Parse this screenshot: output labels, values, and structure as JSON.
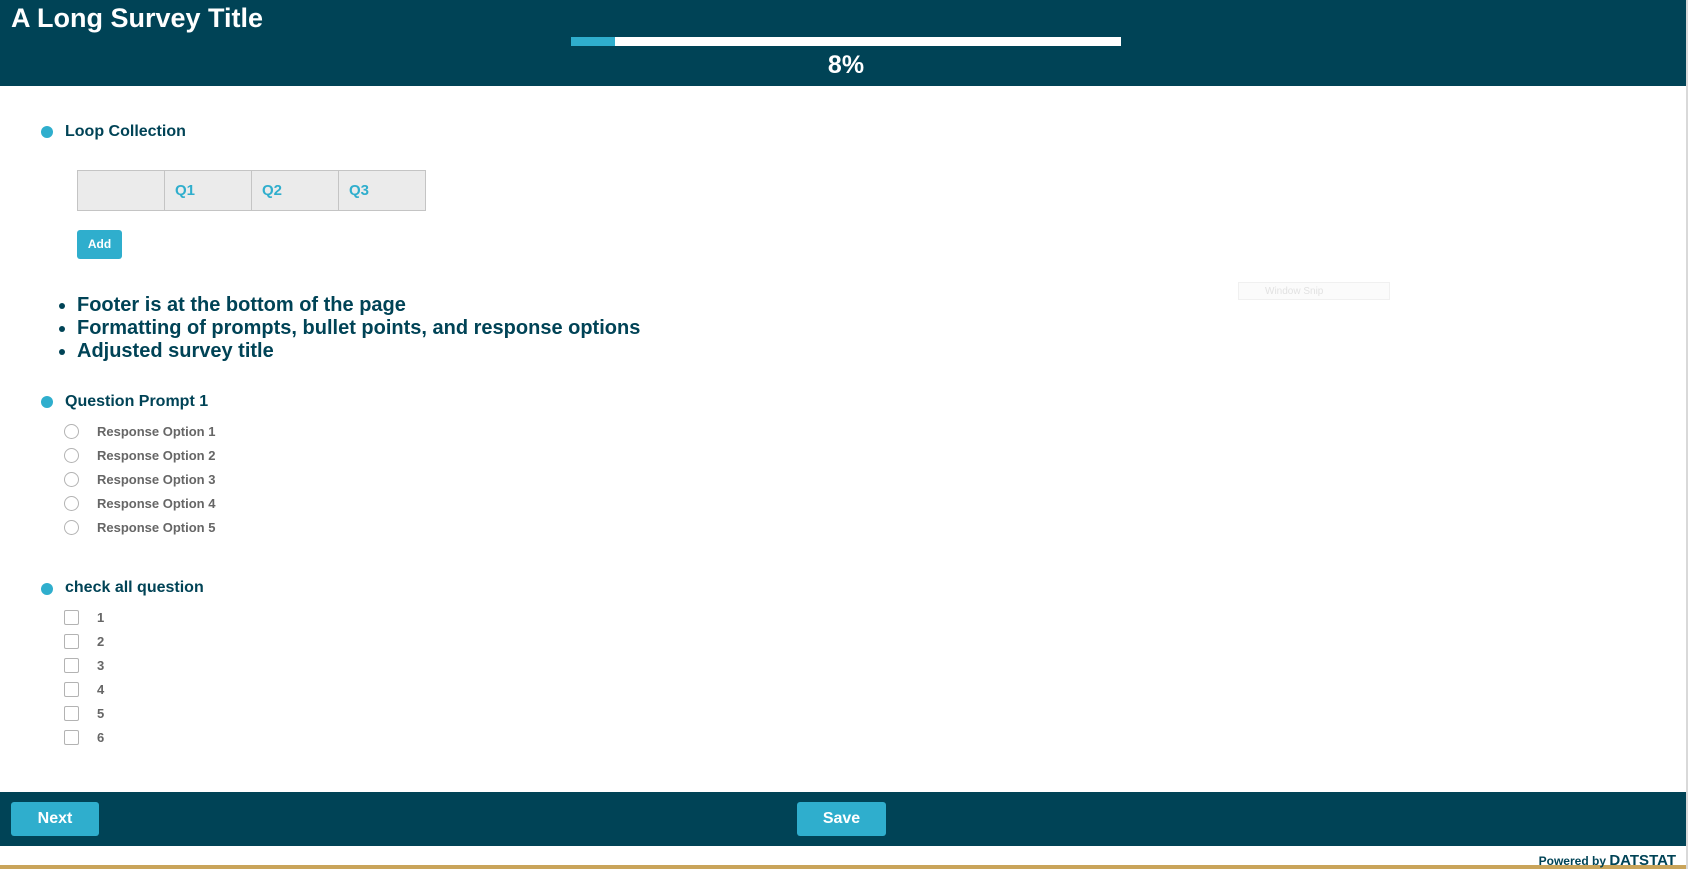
{
  "header": {
    "title": "A Long Survey Title",
    "progress_label": "8%",
    "progress_fraction": 0.08
  },
  "loop_section": {
    "prompt": "Loop Collection",
    "columns": [
      "",
      "Q1",
      "Q2",
      "Q3"
    ],
    "add_label": "Add"
  },
  "notes": [
    "Footer is at the bottom of the page",
    "Formatting of prompts, bullet points, and response options",
    "Adjusted survey title"
  ],
  "overlay": {
    "window_snip": "Window Snip"
  },
  "question1": {
    "prompt": "Question Prompt 1",
    "options": [
      "Response Option 1",
      "Response Option 2",
      "Response Option 3",
      "Response Option 4",
      "Response Option 5"
    ]
  },
  "question2": {
    "prompt": "check all question",
    "options": [
      "1",
      "2",
      "3",
      "4",
      "5",
      "6"
    ]
  },
  "footer": {
    "next_label": "Next",
    "save_label": "Save",
    "powered_prefix": "Powered by",
    "powered_brand": "DATSTAT"
  },
  "colors": {
    "primary": "#004356",
    "accent": "#2faecd"
  }
}
